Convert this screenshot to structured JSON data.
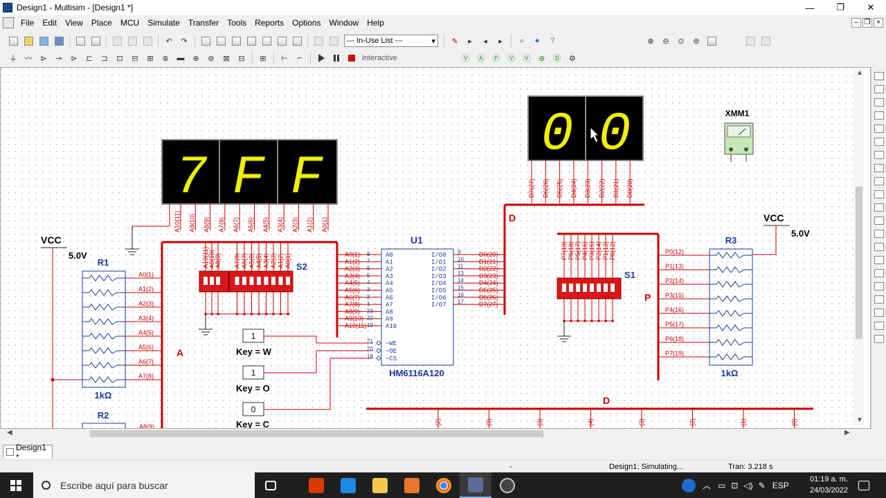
{
  "window": {
    "title": "Design1 - Multisim - [Design1 *]",
    "minimize": "—",
    "maximize": "❐",
    "close": "✕"
  },
  "menu": [
    "File",
    "Edit",
    "View",
    "Place",
    "MCU",
    "Simulate",
    "Transfer",
    "Tools",
    "Reports",
    "Options",
    "Window",
    "Help"
  ],
  "toolbar": {
    "in_use_list": "--- In-Use List ---",
    "interactive": "Interactive"
  },
  "schematic": {
    "vcc_left_label": "VCC",
    "vcc_left_voltage": "5.0V",
    "vcc_right_label": "VCC",
    "vcc_right_voltage": "5.0V",
    "r1_label": "R1",
    "r1_value": "1kΩ",
    "r2_label": "R2",
    "r3_label": "R3",
    "r3_value": "1kΩ",
    "s1_label": "S1",
    "s2_label": "S2",
    "u1_label": "U1",
    "u1_part": "HM6116A120",
    "xmm1_label": "XMM1",
    "bus_a": "A",
    "bus_d_top": "D",
    "bus_d_bottom": "D",
    "bus_p": "P",
    "display_left": [
      "7",
      "F",
      "F"
    ],
    "display_right": [
      "0",
      "0"
    ],
    "key_w_value": "1",
    "key_w_label": "Key = W",
    "key_o_value": "1",
    "key_o_label": "Key = O",
    "key_c_value": "0",
    "key_c_label": "Key = C",
    "u1_address_pins": [
      "A0",
      "A1",
      "A2",
      "A3",
      "A4",
      "A5",
      "A6",
      "A7",
      "A8",
      "A9",
      "A10"
    ],
    "u1_address_pin_numbers": [
      "8",
      "7",
      "6",
      "5",
      "4",
      "3",
      "2",
      "1",
      "23",
      "22",
      "19"
    ],
    "u1_data_pins": [
      "I/O0",
      "I/O1",
      "I/O2",
      "I/O3",
      "I/O4",
      "I/O5",
      "I/O6",
      "I/O7"
    ],
    "u1_data_pin_numbers": [
      "9",
      "10",
      "11",
      "13",
      "14",
      "15",
      "16",
      "17"
    ],
    "u1_control_pins": [
      "~WE",
      "~OE",
      "~CS"
    ],
    "u1_control_pin_numbers": [
      "21",
      "20",
      "18"
    ],
    "address_nets": [
      "A0(1)",
      "A1(2)",
      "A2(3)",
      "A3(4)",
      "A4(5)",
      "A5(6)",
      "A6(7)",
      "A7(8)",
      "A8(9)",
      "A9(10)",
      "A10(11)"
    ],
    "data_nets": [
      "D0(20)",
      "D1(21)",
      "D2(22)",
      "D3(23)",
      "D4(24)",
      "D5(25)",
      "D6(26)",
      "D7(27)"
    ],
    "r1_nets": [
      "A0(1)",
      "A1(2)",
      "A2(3)",
      "A3(4)",
      "A4(5)",
      "A5(6)",
      "A6(7)",
      "A7(8)"
    ],
    "r3_nets": [
      "P0(12)",
      "P1(13)",
      "P2(14)",
      "P3(15)",
      "P4(16)",
      "P5(17)",
      "P6(18)",
      "P7(19)"
    ],
    "r2_net_partial": "A8(9)",
    "left_display_nets": [
      "A10(11)",
      "A9(10)",
      "A8(9)",
      "A7(8)",
      "A6(7)",
      "A5(6)",
      "A4(5)",
      "A3(4)",
      "A2(3)",
      "A1(2)",
      "A0(1)"
    ],
    "right_display_nets": [
      "D7(27)",
      "D6(26)",
      "D5(25)",
      "D4(24)",
      "D3(23)",
      "D2(22)",
      "D1(21)",
      "D0(20)"
    ],
    "s2_nets": [
      "A10(11)",
      "A9(10)",
      "A8(9)",
      "A7(8)",
      "A6(7)",
      "A5(6)",
      "A4(5)",
      "A3(4)",
      "A2(3)",
      "A1(2)",
      "A0(1)"
    ],
    "s1_nets": [
      "P7(19)",
      "P6(18)",
      "P5(17)",
      "P4(16)",
      "P3(15)",
      "P2(14)",
      "P1(13)",
      "P0(12)"
    ],
    "bottom_bus_nets": [
      "(2)",
      "(3)",
      "(3)",
      "(4)",
      "(3)",
      "(2)",
      "(1)",
      "(0)"
    ]
  },
  "tabs": {
    "doc": "Design1 *"
  },
  "status": {
    "dash": "-",
    "simulating": "Design1: Simulating...",
    "tran": "Tran: 3.218 s"
  },
  "taskbar": {
    "search_placeholder": "Escribe aquí para buscar",
    "lang": "ESP",
    "time": "01:19 a. m.",
    "date": "24/03/2022"
  }
}
